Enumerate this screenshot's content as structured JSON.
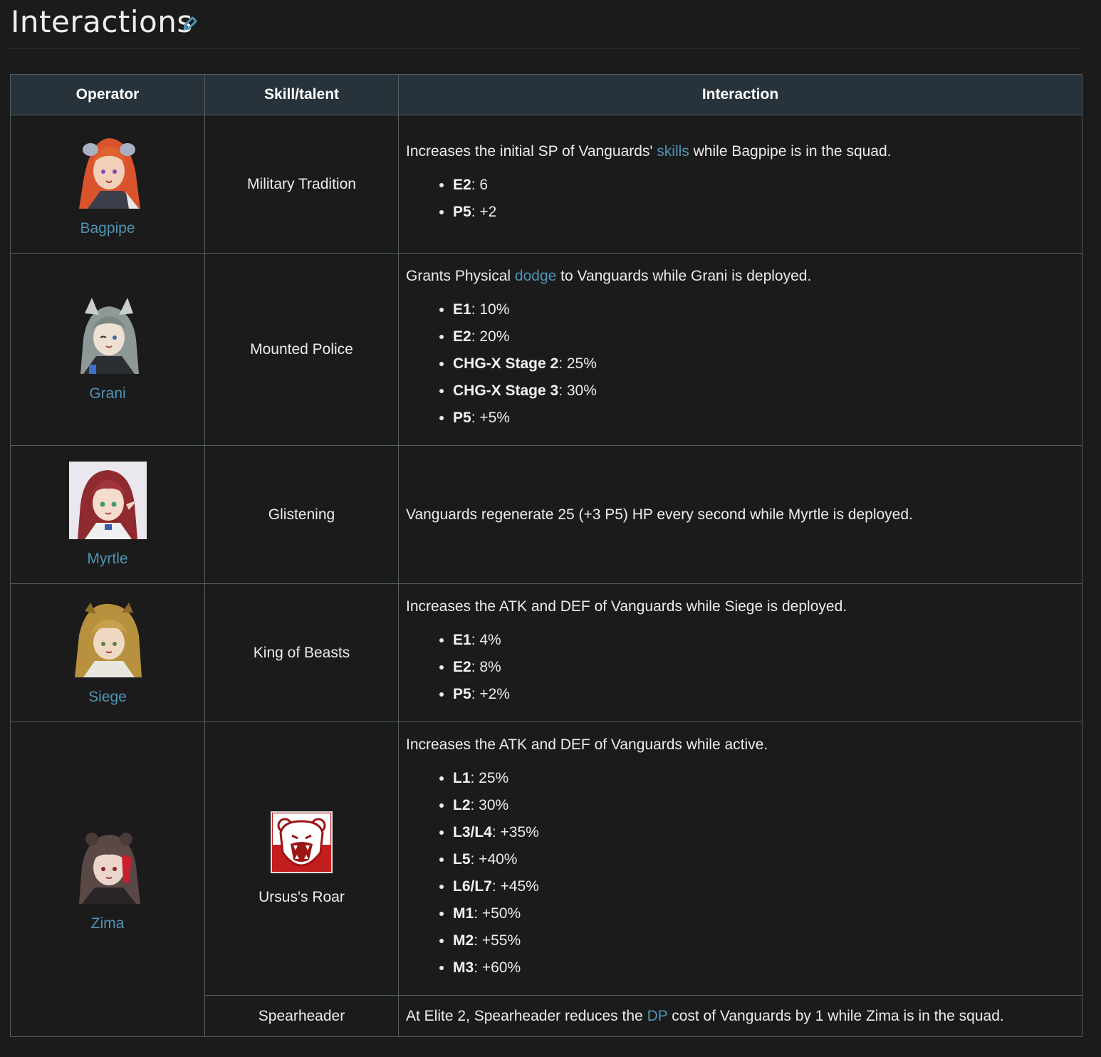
{
  "section": {
    "title": "Interactions",
    "edit_icon": "pencil-icon"
  },
  "table": {
    "headers": [
      "Operator",
      "Skill/talent",
      "Interaction"
    ],
    "rows": [
      {
        "operator": "Bagpipe",
        "skill": "Military Tradition",
        "desc_before": "Increases the initial SP of Vanguards'",
        "link": "skills",
        "desc_after": "while Bagpipe is in the squad.",
        "bullets": [
          {
            "label": "E2",
            "value": ": 6"
          },
          {
            "label": "P5",
            "value": ": +2"
          }
        ]
      },
      {
        "operator": "Grani",
        "skill": "Mounted Police",
        "desc_before": "Grants Physical",
        "link": "dodge",
        "desc_after": "to Vanguards while Grani is deployed.",
        "bullets": [
          {
            "label": "E1",
            "value": ": 10%"
          },
          {
            "label": "E2",
            "value": ": 20%"
          },
          {
            "label": "CHG-X Stage 2",
            "value": ": 25%"
          },
          {
            "label": "CHG-X Stage 3",
            "value": ": 30%"
          },
          {
            "label": "P5",
            "value": ": +5%"
          }
        ]
      },
      {
        "operator": "Myrtle",
        "skill": "Glistening",
        "desc": "Vanguards regenerate 25 (+3 P5) HP every second while Myrtle is deployed."
      },
      {
        "operator": "Siege",
        "skill": "King of Beasts",
        "desc": "Increases the ATK and DEF of Vanguards while Siege is deployed.",
        "bullets": [
          {
            "label": "E1",
            "value": ": 4%"
          },
          {
            "label": "E2",
            "value": ": 8%"
          },
          {
            "label": "P5",
            "value": ": +2%"
          }
        ]
      },
      {
        "operator": "Zima",
        "skill": "Ursus's Roar",
        "skill_icon": "roaring-bear-icon",
        "desc": "Increases the ATK and DEF of Vanguards while active.",
        "bullets": [
          {
            "label": "L1",
            "value": ": 25%"
          },
          {
            "label": "L2",
            "value": ": 30%"
          },
          {
            "label": "L3/L4",
            "value": ": +35%"
          },
          {
            "label": "L5",
            "value": ": +40%"
          },
          {
            "label": "L6/L7",
            "value": ": +45%"
          },
          {
            "label": "M1",
            "value": ": +50%"
          },
          {
            "label": "M2",
            "value": ": +55%"
          },
          {
            "label": "M3",
            "value": ": +60%"
          }
        ]
      },
      {
        "skill": "Spearheader",
        "desc_before": "At Elite 2, Spearheader reduces the",
        "link": "DP",
        "desc_after": "cost of Vanguards by 1 while Zima is in the squad."
      }
    ]
  },
  "colors": {
    "background": "#1b1b1b",
    "header_bg": "#28323a",
    "link": "#4e95b5",
    "border": "#545f5f"
  }
}
